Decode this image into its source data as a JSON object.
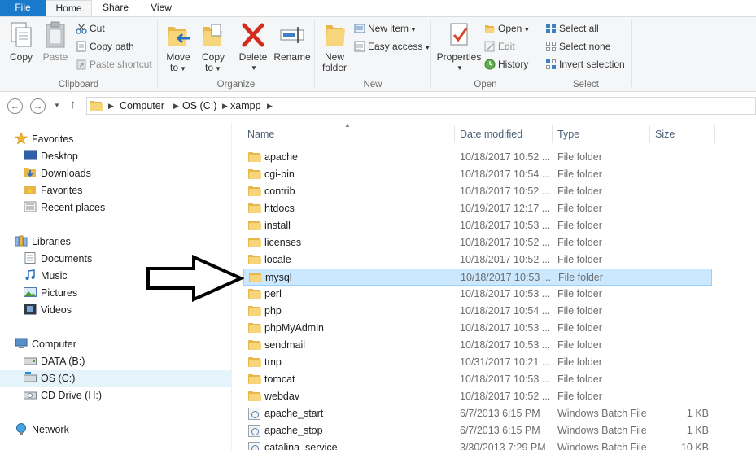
{
  "tabs": {
    "file": "File",
    "home": "Home",
    "share": "Share",
    "view": "View"
  },
  "ribbon": {
    "clipboard": {
      "label": "Clipboard",
      "copy": "Copy",
      "paste": "Paste",
      "cut": "Cut",
      "copy_path": "Copy path",
      "paste_shortcut": "Paste shortcut"
    },
    "organize": {
      "label": "Organize",
      "move_to": [
        "Move",
        "to"
      ],
      "copy_to": [
        "Copy",
        "to"
      ],
      "delete": "Delete",
      "rename": "Rename"
    },
    "new": {
      "label": "New",
      "new_folder": [
        "New",
        "folder"
      ],
      "new_item": "New item",
      "easy_access": "Easy access"
    },
    "open": {
      "label": "Open",
      "properties": "Properties",
      "open": "Open",
      "edit": "Edit",
      "history": "History"
    },
    "select": {
      "label": "Select",
      "select_all": "Select all",
      "select_none": "Select none",
      "invert_selection": "Invert selection"
    }
  },
  "address": {
    "crumbs": [
      "Computer",
      "OS (C:)",
      "xampp"
    ]
  },
  "navpane": {
    "favorites": "Favorites",
    "favorites_items": [
      "Desktop",
      "Downloads",
      "Favorites",
      "Recent places"
    ],
    "libraries": "Libraries",
    "libraries_items": [
      "Documents",
      "Music",
      "Pictures",
      "Videos"
    ],
    "computer": "Computer",
    "computer_items": [
      "DATA (B:)",
      "OS (C:)",
      "CD Drive (H:)"
    ],
    "network": "Network"
  },
  "columns": {
    "name": "Name",
    "date": "Date modified",
    "type": "Type",
    "size": "Size"
  },
  "files": [
    {
      "name": "apache",
      "date": "10/18/2017 10:52 ...",
      "type": "File folder",
      "size": "",
      "kind": "folder"
    },
    {
      "name": "cgi-bin",
      "date": "10/18/2017 10:54 ...",
      "type": "File folder",
      "size": "",
      "kind": "folder"
    },
    {
      "name": "contrib",
      "date": "10/18/2017 10:52 ...",
      "type": "File folder",
      "size": "",
      "kind": "folder"
    },
    {
      "name": "htdocs",
      "date": "10/19/2017 12:17 ...",
      "type": "File folder",
      "size": "",
      "kind": "folder"
    },
    {
      "name": "install",
      "date": "10/18/2017 10:53 ...",
      "type": "File folder",
      "size": "",
      "kind": "folder"
    },
    {
      "name": "licenses",
      "date": "10/18/2017 10:52 ...",
      "type": "File folder",
      "size": "",
      "kind": "folder"
    },
    {
      "name": "locale",
      "date": "10/18/2017 10:52 ...",
      "type": "File folder",
      "size": "",
      "kind": "folder"
    },
    {
      "name": "mysql",
      "date": "10/18/2017 10:53 ...",
      "type": "File folder",
      "size": "",
      "kind": "folder",
      "selected": true
    },
    {
      "name": "perl",
      "date": "10/18/2017 10:53 ...",
      "type": "File folder",
      "size": "",
      "kind": "folder"
    },
    {
      "name": "php",
      "date": "10/18/2017 10:54 ...",
      "type": "File folder",
      "size": "",
      "kind": "folder"
    },
    {
      "name": "phpMyAdmin",
      "date": "10/18/2017 10:53 ...",
      "type": "File folder",
      "size": "",
      "kind": "folder"
    },
    {
      "name": "sendmail",
      "date": "10/18/2017 10:53 ...",
      "type": "File folder",
      "size": "",
      "kind": "folder"
    },
    {
      "name": "tmp",
      "date": "10/31/2017 10:21 ...",
      "type": "File folder",
      "size": "",
      "kind": "folder"
    },
    {
      "name": "tomcat",
      "date": "10/18/2017 10:53 ...",
      "type": "File folder",
      "size": "",
      "kind": "folder"
    },
    {
      "name": "webdav",
      "date": "10/18/2017 10:52 ...",
      "type": "File folder",
      "size": "",
      "kind": "folder"
    },
    {
      "name": "apache_start",
      "date": "6/7/2013 6:15 PM",
      "type": "Windows Batch File",
      "size": "1 KB",
      "kind": "batch"
    },
    {
      "name": "apache_stop",
      "date": "6/7/2013 6:15 PM",
      "type": "Windows Batch File",
      "size": "1 KB",
      "kind": "batch"
    },
    {
      "name": "catalina_service",
      "date": "3/30/2013 7:29 PM",
      "type": "Windows Batch File",
      "size": "10 KB",
      "kind": "batch"
    }
  ]
}
